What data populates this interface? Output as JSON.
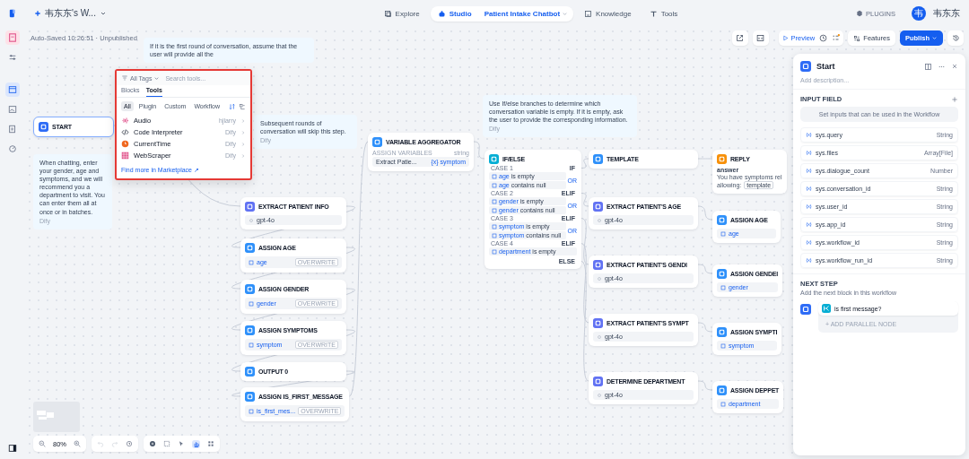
{
  "topbar": {
    "workspace": "韦东东's W...",
    "nav": [
      {
        "label": "Explore",
        "selected": false
      },
      {
        "label": "Studio",
        "selected": true
      },
      {
        "label": "Knowledge",
        "selected": false
      },
      {
        "label": "Tools",
        "selected": false
      }
    ],
    "app_name": "Patient Intake Chatbot",
    "plugins": "PLUGINS",
    "avatar": "韦",
    "user": "韦东东"
  },
  "toolbar": {
    "autosave": "Auto-Saved 10:26:51 · Unpublished",
    "preview": "Preview",
    "features": "Features",
    "publish": "Publish"
  },
  "notes": [
    {
      "text": "If it is the first round of conversation, assume that the user will provide all the"
    },
    {
      "text": "Subsequent rounds of conversation will skip this step.",
      "author": "Dify"
    },
    {
      "text": "Use If/else branches to determine which conversation variable is empty. If it is empty, ask the user to provide the corresponding information.",
      "author": "Dify"
    },
    {
      "text": "When chatting, enter your gender, age and symptoms, and we will recommend you a department to visit. You can enter them all at once or in batches.",
      "author": "Dify"
    }
  ],
  "tool_picker": {
    "tag_filter": "All Tags",
    "search": {
      "placeholder": "Search tools..."
    },
    "tabs": [
      {
        "label": "Blocks",
        "selected": false
      },
      {
        "label": "Tools",
        "selected": true
      }
    ],
    "filters": [
      {
        "label": "All",
        "selected": true
      },
      {
        "label": "Plugin",
        "selected": false
      },
      {
        "label": "Custom",
        "selected": false
      },
      {
        "label": "Workflow",
        "selected": false
      }
    ],
    "tools": [
      {
        "name": "Audio",
        "provider": "hjlarry",
        "kind": "audio"
      },
      {
        "name": "Code Interpreter",
        "provider": "Dify",
        "kind": "code"
      },
      {
        "name": "CurrentTime",
        "provider": "Dify",
        "kind": "time"
      },
      {
        "name": "WebScraper",
        "provider": "Dify",
        "kind": "scraper"
      }
    ],
    "marketplace_link": "Find more in Marketplace ↗"
  },
  "nodes": [
    {
      "kind": "start",
      "title": "START"
    },
    {
      "kind": "llm",
      "title": "EXTRACT PATIENT INFO",
      "model": "gpt-4o"
    },
    {
      "kind": "assign",
      "title": "ASSIGN AGE",
      "variable": "age",
      "mode": "OVERWRITE"
    },
    {
      "kind": "assign",
      "title": "ASSIGN GENDER",
      "variable": "gender",
      "mode": "OVERWRITE"
    },
    {
      "kind": "assign",
      "title": "ASSIGN SYMPTOMS",
      "variable": "symptom",
      "mode": "OVERWRITE"
    },
    {
      "kind": "output",
      "title": "OUTPUT 0"
    },
    {
      "kind": "assign",
      "title": "ASSIGN IS_FIRST_MESSAGE",
      "variable": "is_first_mes...",
      "mode": "OVERWRITE"
    },
    {
      "kind": "aggregator",
      "title": "VARIABLE AGGREGATOR",
      "label": "ASSIGN VARIABLES",
      "type": "string",
      "source": "Extract Patie...",
      "variable": "{x} symptom"
    },
    {
      "kind": "ifelse",
      "title": "IF/ELSE",
      "cases": [
        {
          "label": "CASE 1",
          "branch": "IF",
          "conditions": [
            {
              "var": "age",
              "op": "is empty"
            },
            {
              "var": "age",
              "op": "contains null"
            }
          ],
          "logic": "OR"
        },
        {
          "label": "CASE 2",
          "branch": "ELIF",
          "conditions": [
            {
              "var": "gender",
              "op": "is empty"
            },
            {
              "var": "gender",
              "op": "contains null"
            }
          ],
          "logic": "OR"
        },
        {
          "label": "CASE 3",
          "branch": "ELIF",
          "conditions": [
            {
              "var": "symptom",
              "op": "is empty"
            },
            {
              "var": "symptom",
              "op": "contains null"
            }
          ],
          "logic": "OR"
        },
        {
          "label": "CASE 4",
          "branch": "ELIF",
          "conditions": [
            {
              "var": "department",
              "op": "is empty"
            }
          ]
        }
      ],
      "else": "ELSE"
    },
    {
      "kind": "template",
      "title": "TEMPLATE"
    },
    {
      "kind": "llm",
      "title": "EXTRACT PATIENT'S AGE",
      "model": "gpt-4o"
    },
    {
      "kind": "llm",
      "title": "EXTRACT PATIENT'S GENDI",
      "model": "gpt-4o"
    },
    {
      "kind": "llm",
      "title": "EXTRACT PATIENT'S SYMPT",
      "model": "gpt-4o"
    },
    {
      "kind": "llm",
      "title": "DETERMINE DEPARTMENT",
      "model": "gpt-4o"
    },
    {
      "kind": "reply",
      "title": "REPLY",
      "label": "answer",
      "lines": [
        "You have symptoms rel",
        "allowing:"
      ],
      "chip": "template"
    },
    {
      "kind": "assign",
      "title": "ASSIGN AGE",
      "variable": "age"
    },
    {
      "kind": "assign",
      "title": "ASSIGN GENDEI",
      "variable": "gender"
    },
    {
      "kind": "assign",
      "title": "ASSIGN SYMPTI",
      "variable": "symptom"
    },
    {
      "kind": "assign",
      "title": "ASSIGN DEPPET",
      "variable": "department"
    }
  ],
  "zoom": "80%",
  "panel": {
    "title": "Start",
    "description": {
      "placeholder": "Add description..."
    },
    "input_heading": "INPUT FIELD",
    "input_hint": "Set inputs that can be used in the Workflow",
    "variables": [
      {
        "name": "sys.query",
        "type": "String"
      },
      {
        "name": "sys.files",
        "type": "Array[File]"
      },
      {
        "name": "sys.dialogue_count",
        "type": "Number"
      },
      {
        "name": "sys.conversation_id",
        "type": "String"
      },
      {
        "name": "sys.user_id",
        "type": "String"
      },
      {
        "name": "sys.app_id",
        "type": "String"
      },
      {
        "name": "sys.workflow_id",
        "type": "String"
      },
      {
        "name": "sys.workflow_run_id",
        "type": "String"
      }
    ],
    "next_heading": "NEXT STEP",
    "next_hint": "Add the next block in this workflow",
    "next_block": "is first message?",
    "add_parallel": "+ ADD PARALLEL NODE"
  }
}
